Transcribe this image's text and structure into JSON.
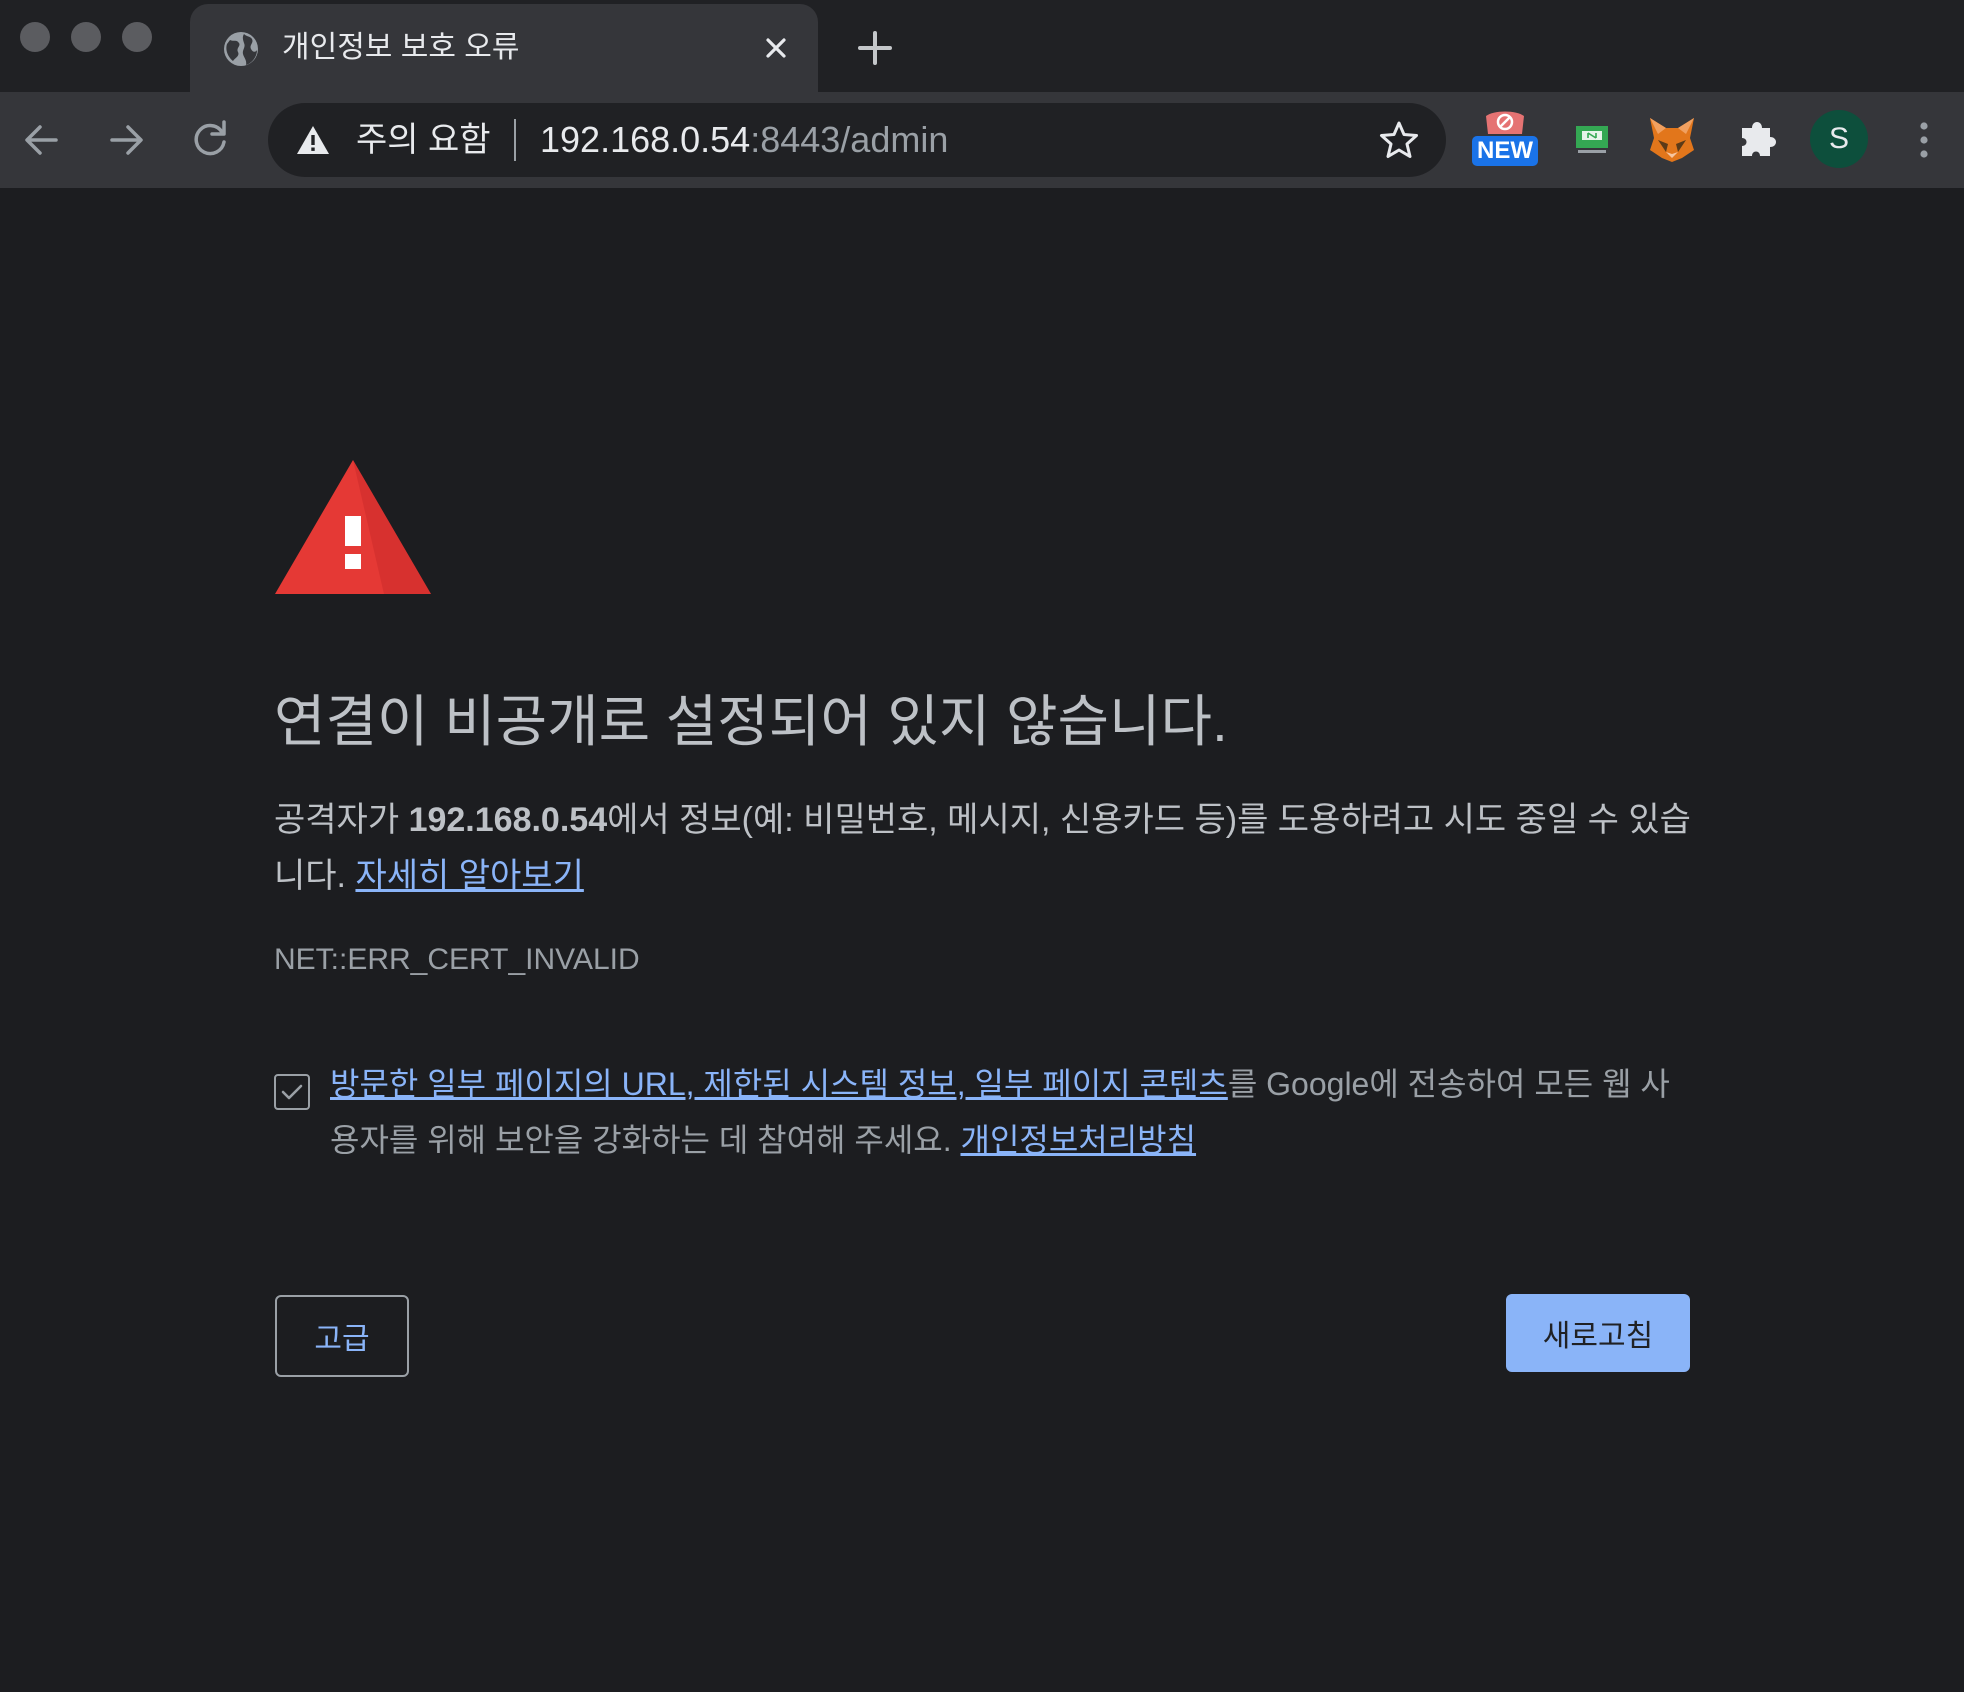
{
  "browser": {
    "tab": {
      "title": "개인정보 보호 오류"
    },
    "address_bar": {
      "security_label": "주의 요함",
      "url_host": "192.168.0.54",
      "url_rest": ":8443/admin"
    },
    "extensions": {
      "new_badge": "NEW"
    },
    "profile_initial": "S"
  },
  "page": {
    "heading": "연결이 비공개로 설정되어 있지 않습니다.",
    "explanation_prefix": "공격자가 ",
    "explanation_host": "192.168.0.54",
    "explanation_suffix": "에서 정보(예: 비밀번호, 메시지, 신용카드 등)를 도용하려고 시도 중일 수 있습니다. ",
    "learn_more_link": "자세히 알아보기",
    "error_code": "NET::ERR_CERT_INVALID",
    "optin": {
      "checked": true,
      "link_text": "방문한 일부 페이지의 URL, 제한된 시스템 정보, 일부 페이지 콘텐츠",
      "text_middle": "를 Google에 전송하여 모든 웹 사용자를 위해 보안을 강화하는 데 참여해 주세요. ",
      "privacy_link": "개인정보처리방침"
    },
    "advanced_button": "고급",
    "reload_button": "새로고침"
  },
  "colors": {
    "background": "#1c1d20",
    "link": "#8ab4f8",
    "primary_button": "#8ab4f8",
    "alert_red": "#e53935"
  },
  "icons": [
    "globe-icon",
    "close-icon",
    "plus-icon",
    "back-arrow-icon",
    "forward-arrow-icon",
    "reload-icon",
    "warning-triangle-icon",
    "star-icon",
    "extension-icon",
    "puzzle-icon",
    "metamask-fox-icon",
    "kebab-menu-icon",
    "alert-triangle-icon",
    "checkmark-icon"
  ]
}
